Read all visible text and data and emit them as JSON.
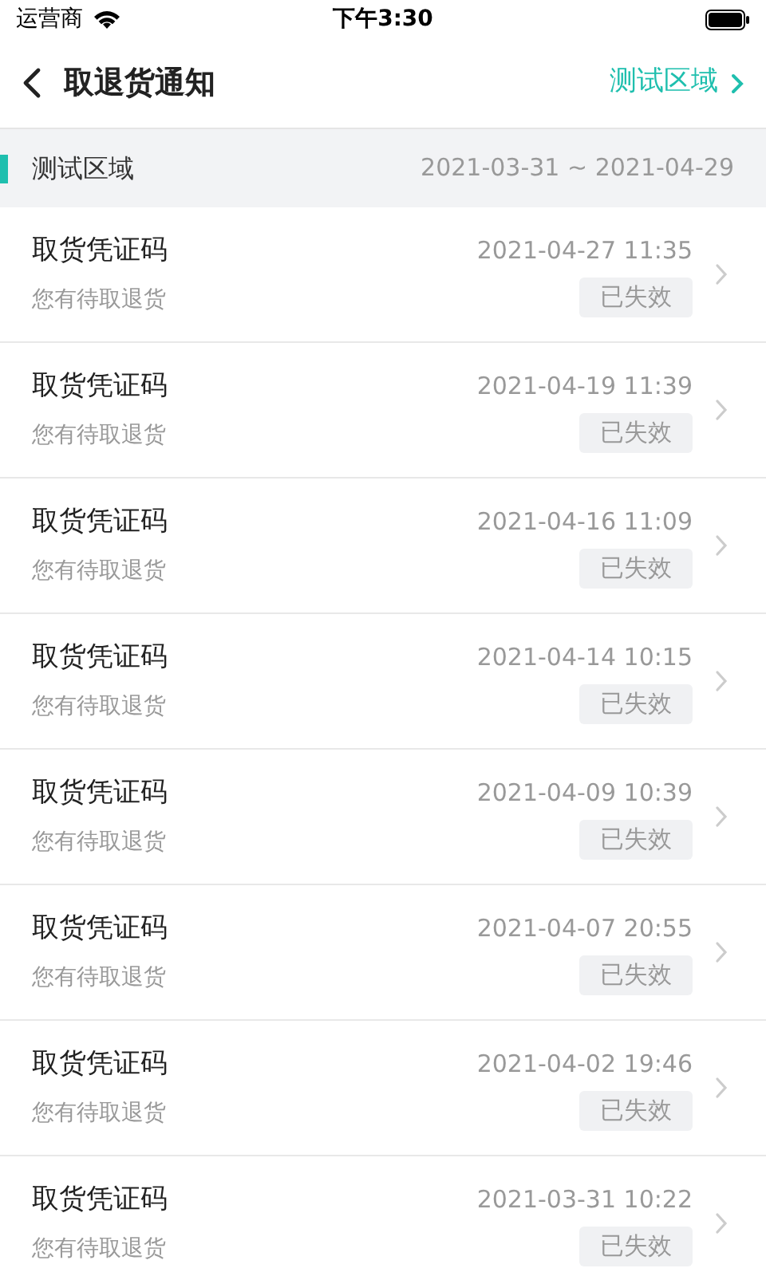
{
  "status_bar": {
    "carrier": "运营商",
    "time": "下午3:30"
  },
  "nav": {
    "title": "取退货通知",
    "region": "测试区域"
  },
  "section": {
    "title": "测试区域",
    "range": "2021-03-31 ~ 2021-04-29"
  },
  "rows": [
    {
      "title": "取货凭证码",
      "subtitle": "您有待取退货",
      "time": "2021-04-27 11:35",
      "status": "已失效"
    },
    {
      "title": "取货凭证码",
      "subtitle": "您有待取退货",
      "time": "2021-04-19 11:39",
      "status": "已失效"
    },
    {
      "title": "取货凭证码",
      "subtitle": "您有待取退货",
      "time": "2021-04-16 11:09",
      "status": "已失效"
    },
    {
      "title": "取货凭证码",
      "subtitle": "您有待取退货",
      "time": "2021-04-14 10:15",
      "status": "已失效"
    },
    {
      "title": "取货凭证码",
      "subtitle": "您有待取退货",
      "time": "2021-04-09 10:39",
      "status": "已失效"
    },
    {
      "title": "取货凭证码",
      "subtitle": "您有待取退货",
      "time": "2021-04-07 20:55",
      "status": "已失效"
    },
    {
      "title": "取货凭证码",
      "subtitle": "您有待取退货",
      "time": "2021-04-02 19:46",
      "status": "已失效"
    },
    {
      "title": "取货凭证码",
      "subtitle": "您有待取退货",
      "time": "2021-03-31 10:22",
      "status": "已失效"
    }
  ]
}
